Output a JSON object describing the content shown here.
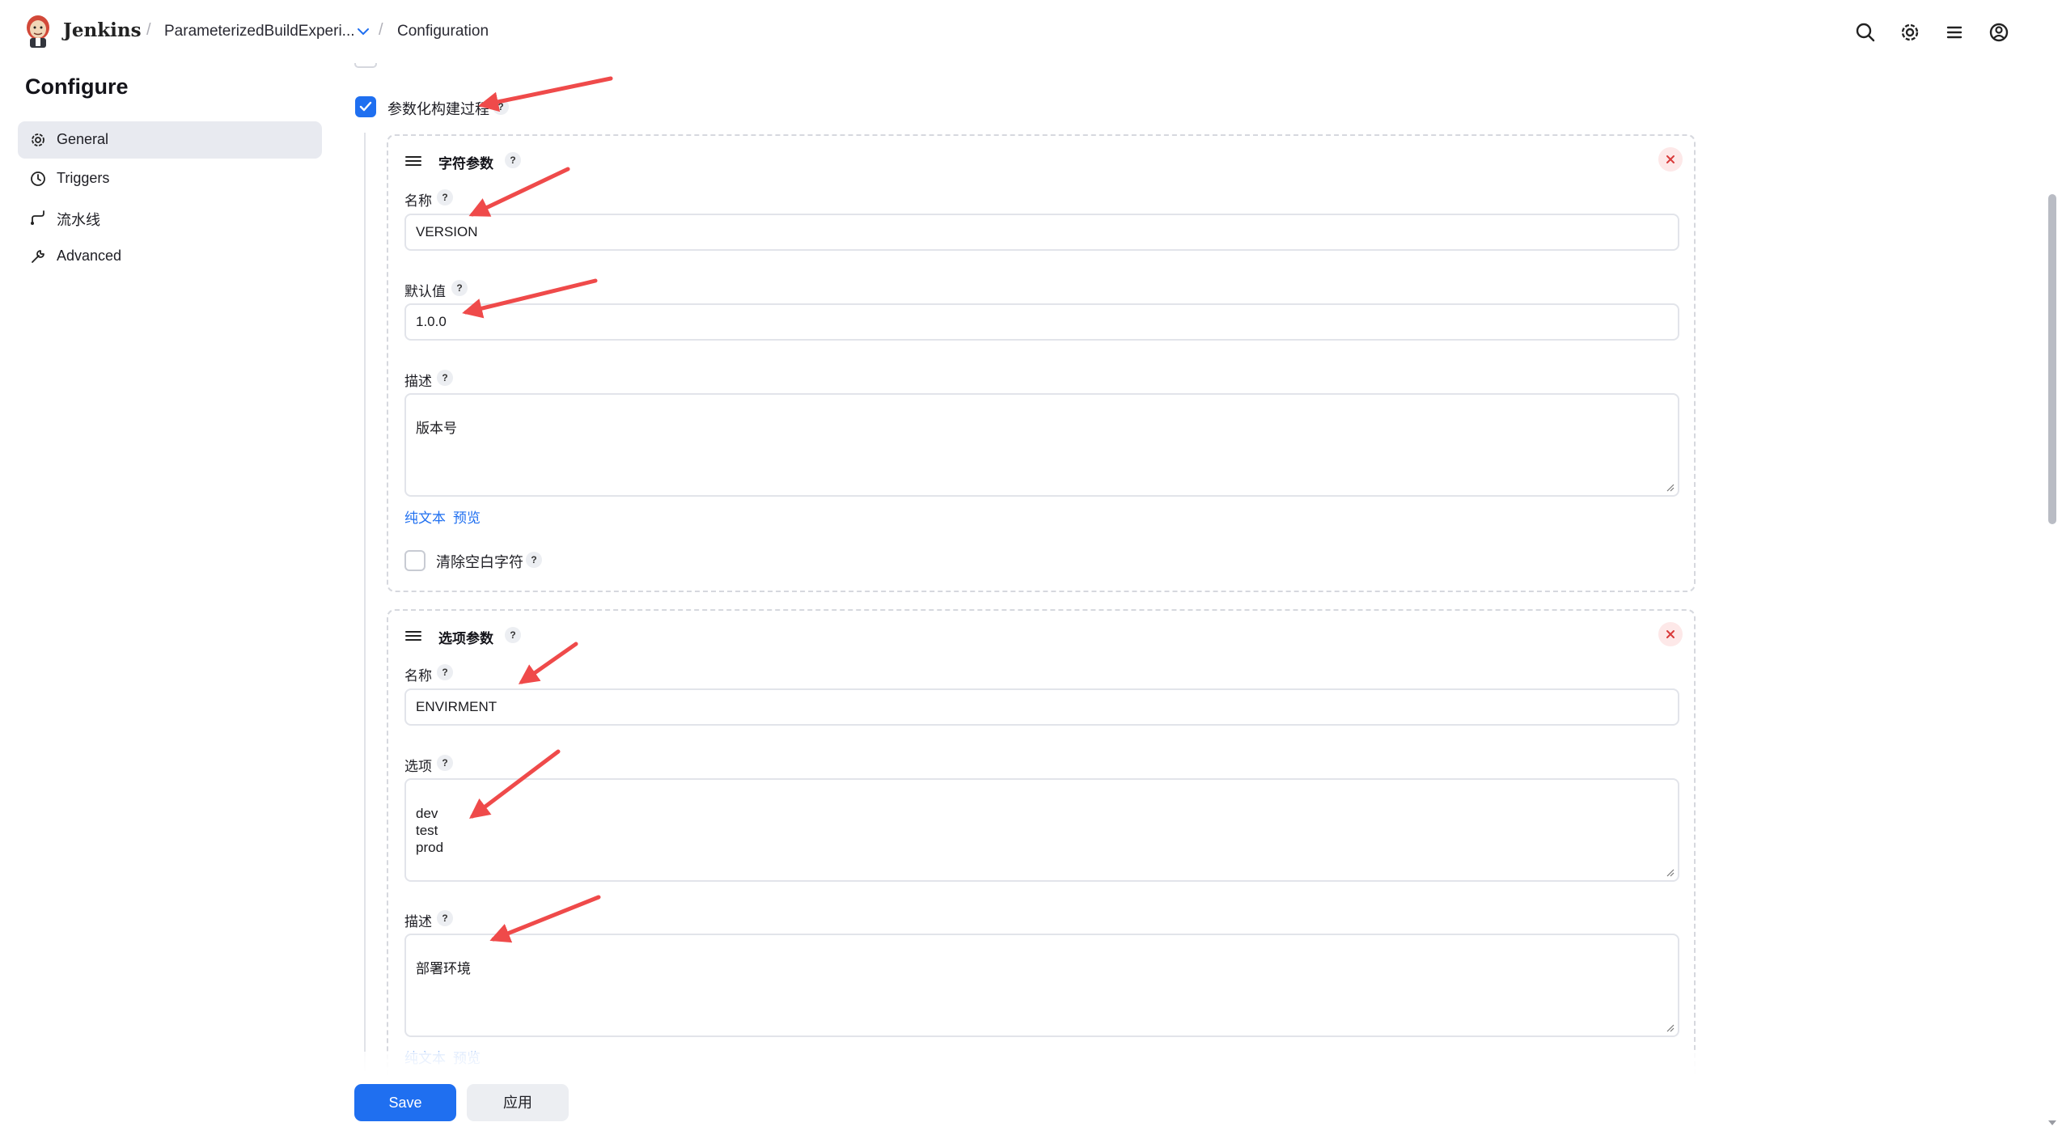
{
  "header": {
    "brand": "Jenkins",
    "breadcrumb_job": "ParameterizedBuildExperi...",
    "breadcrumb_page": "Configuration",
    "separator": "/"
  },
  "sidebar": {
    "title": "Configure",
    "items": [
      {
        "label": "General",
        "icon": "gear-icon",
        "active": true
      },
      {
        "label": "Triggers",
        "icon": "clock-icon",
        "active": false
      },
      {
        "label": "流水线",
        "icon": "pipeline-icon",
        "active": false
      },
      {
        "label": "Advanced",
        "icon": "wrench-icon",
        "active": false
      }
    ]
  },
  "main": {
    "parameterized_checkbox": {
      "label": "参数化构建过程",
      "checked": true
    },
    "help_glyph": "?",
    "string_param": {
      "title": "字符参数",
      "name_label": "名称",
      "name_value": "VERSION",
      "default_label": "默认值",
      "default_value": "1.0.0",
      "desc_label": "描述",
      "desc_value": "版本号",
      "plain_text_link": "纯文本",
      "preview_link": "预览",
      "trim_label": "清除空白字符",
      "trim_checked": false
    },
    "choice_param": {
      "title": "选项参数",
      "name_label": "名称",
      "name_value": "ENVIRMENT",
      "choices_label": "选项",
      "choices_value": "dev\ntest\nprod",
      "desc_label": "描述",
      "desc_value": "部署环境",
      "plain_text_link": "纯文本",
      "preview_link": "预览"
    }
  },
  "buttons": {
    "save": "Save",
    "apply": "应用"
  },
  "colors": {
    "primary": "#1f6ff0",
    "annotation_arrow": "#ef4a4a",
    "close_tint": "#fde8e8"
  }
}
